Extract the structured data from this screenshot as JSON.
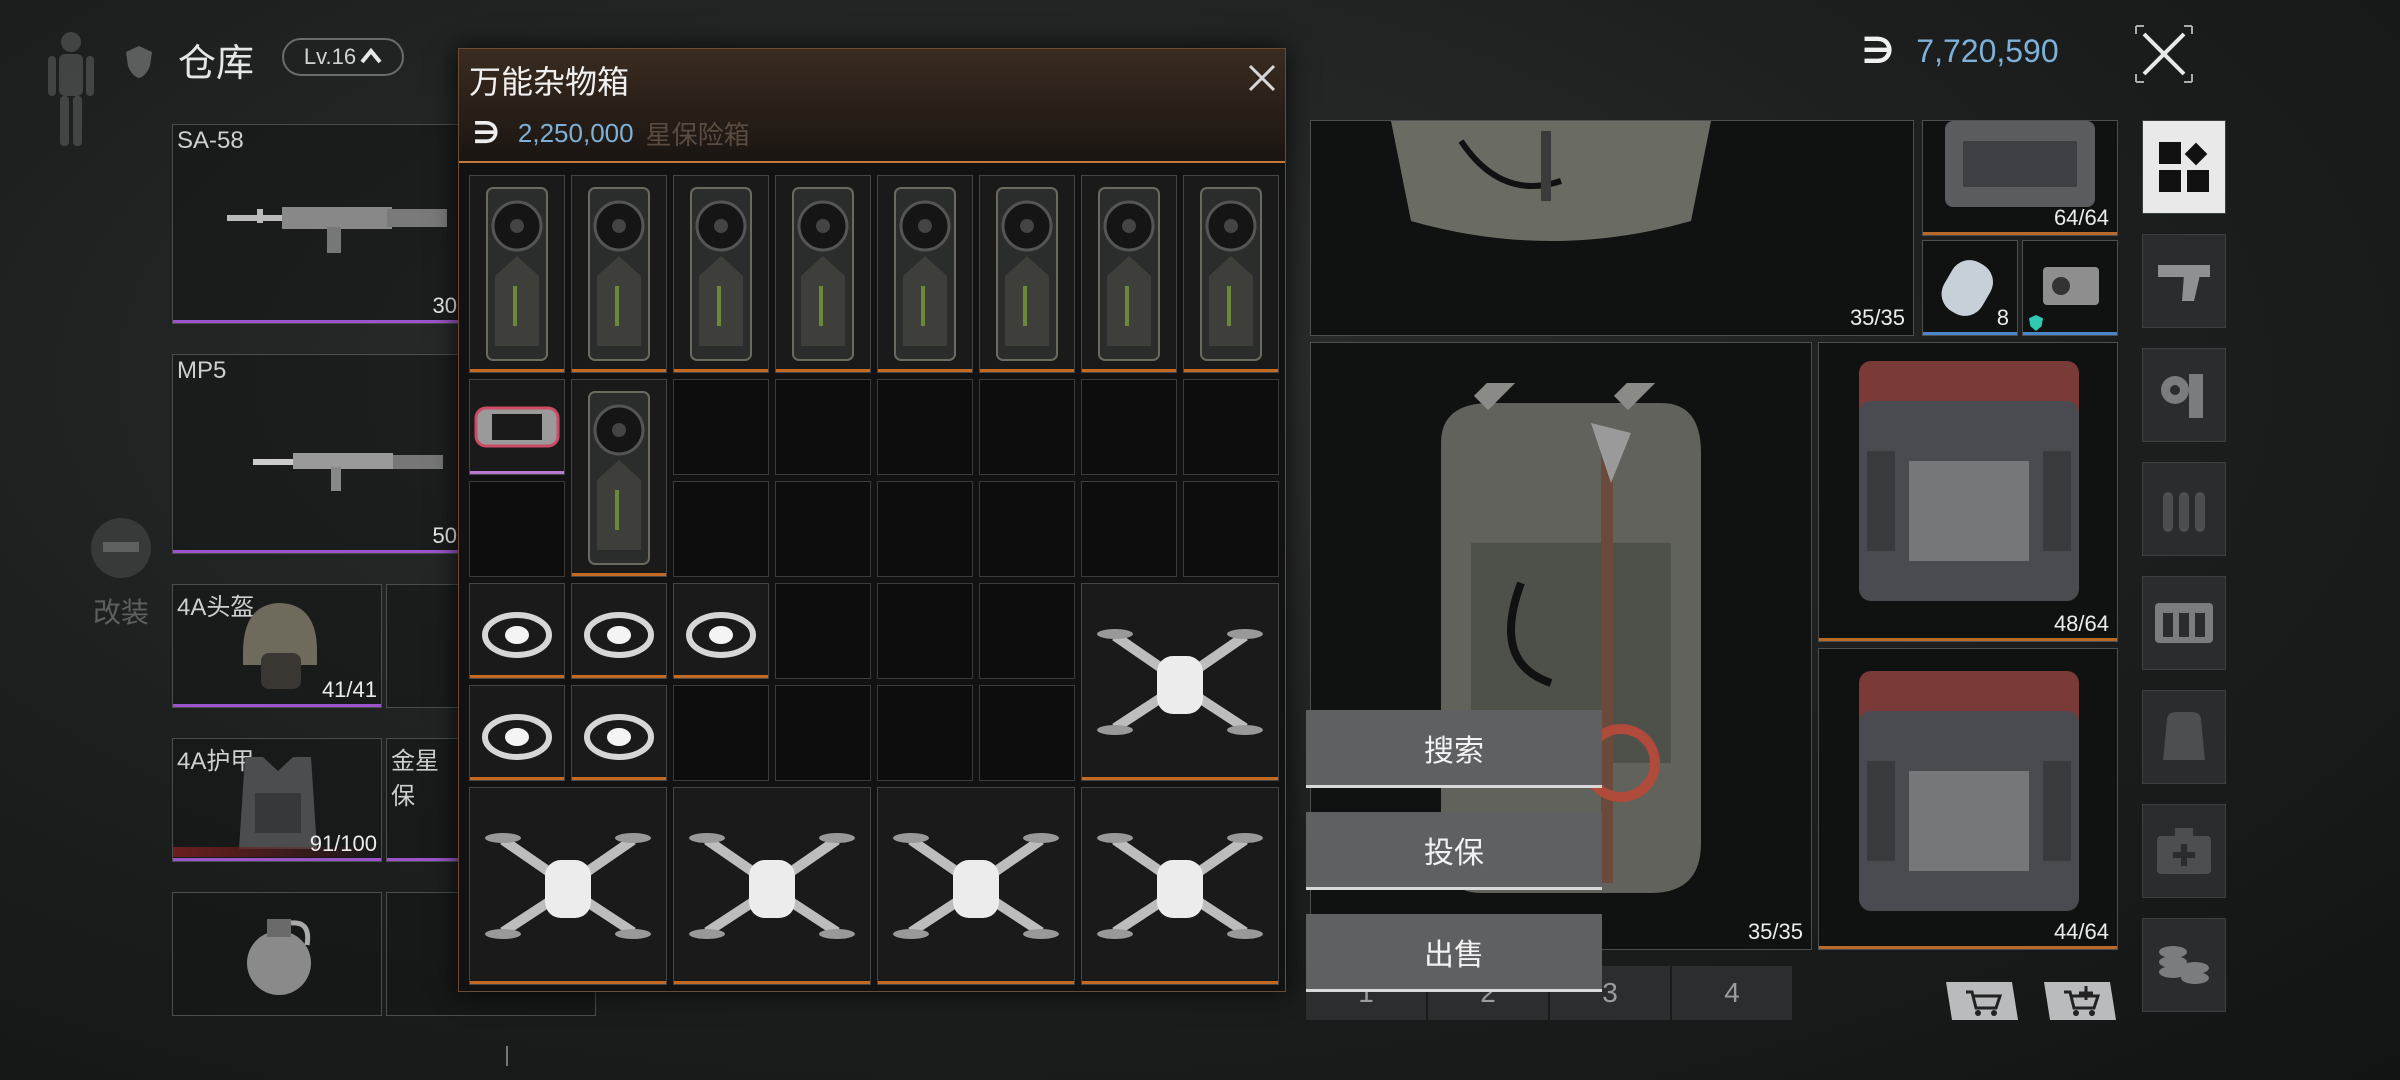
{
  "header": {
    "title": "仓库",
    "level": "Lv.16",
    "coins": "7,720,590",
    "coin_symbol": "∋"
  },
  "left": {
    "weapon1": {
      "name": "SA-58",
      "count": "30"
    },
    "weapon2": {
      "name": "MP5",
      "count": "50"
    },
    "helmet": {
      "name": "4A头盔",
      "durability": "41/41"
    },
    "armor": {
      "name": "4A护甲",
      "durability": "91/100"
    },
    "safebox": {
      "name": "金星保"
    },
    "modify_label": "改装"
  },
  "popup": {
    "title": "万能杂物箱",
    "coin_symbol": "∋",
    "price": "2,250,000",
    "ghost_text": "星保险箱",
    "items": {
      "gpu": "RTX 3080",
      "ring": "戒指",
      "drone": "无人机",
      "console": "掌机"
    }
  },
  "right": {
    "top_backpack_cap": "35/35",
    "small_box_cap": "64/64",
    "dogtag_count": "8",
    "backpack_cap": "35/35",
    "box1_cap": "48/64",
    "box2_cap": "44/64"
  },
  "menu": {
    "search": "搜索",
    "insure": "投保",
    "sell": "出售"
  },
  "pages": [
    "1",
    "2",
    "3",
    "4"
  ],
  "icons": {
    "cart": "cart-icon",
    "cart_add": "cart-add-icon"
  },
  "colors": {
    "accent_orange": "#c46a22",
    "coin_blue": "#7fb0d8",
    "rarity_purple": "#9b54c9"
  }
}
